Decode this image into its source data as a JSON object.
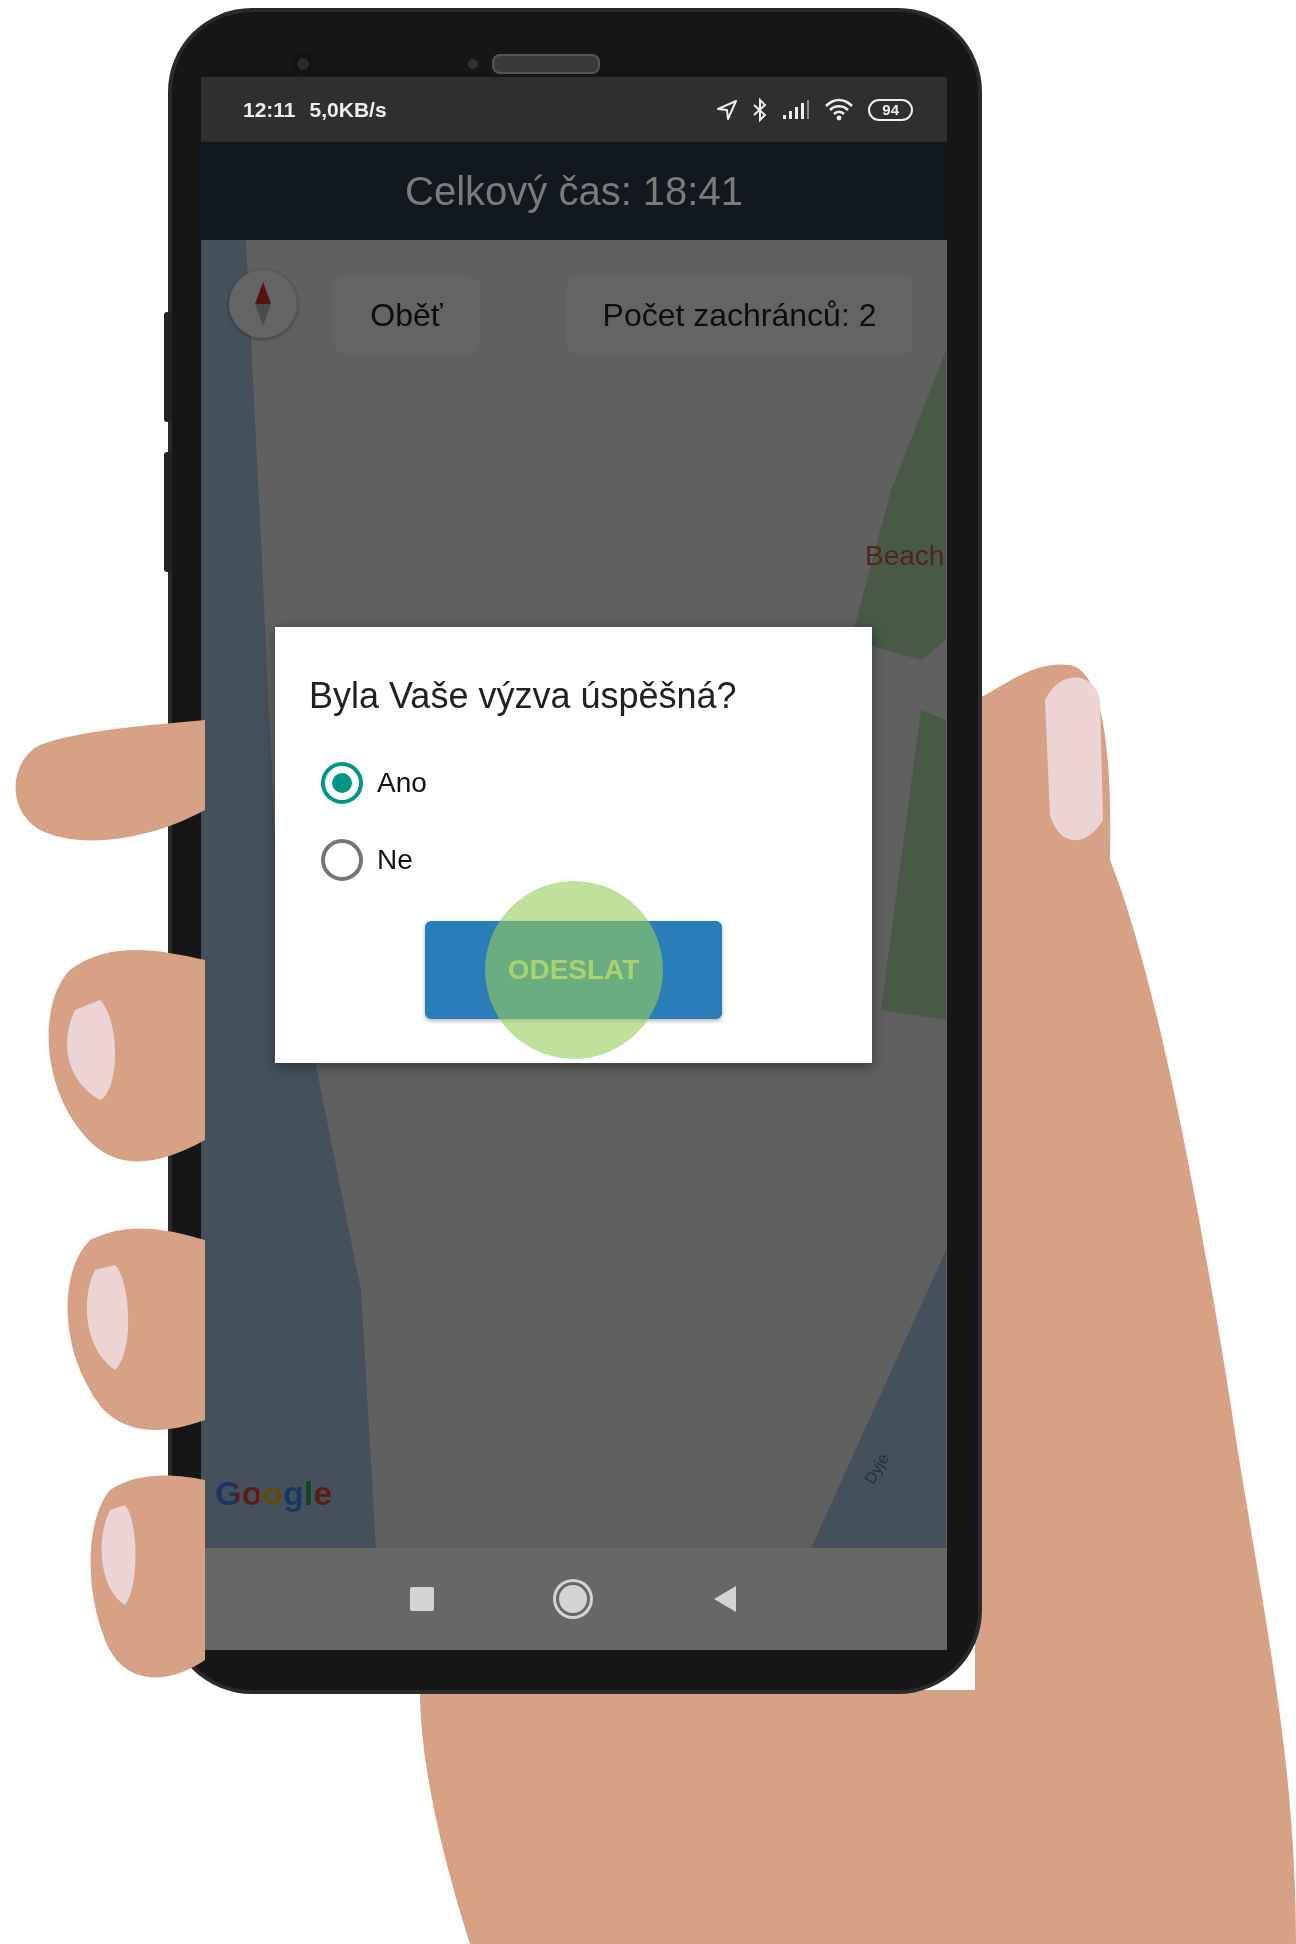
{
  "status_bar": {
    "time": "12:11",
    "speed": "5,0KB/s",
    "battery": "94"
  },
  "header": {
    "title": "Celkový čas: 18:41"
  },
  "map": {
    "chips": [
      "Oběť",
      "Počet zachránců: 2"
    ],
    "labels": [
      {
        "text": "Beach",
        "kind": "place"
      },
      {
        "text": "Dyje",
        "kind": "river"
      }
    ],
    "attribution": "Google"
  },
  "dialog": {
    "title": "Byla Vaše výzva úspěšná?",
    "options": [
      {
        "label": "Ano",
        "selected": true
      },
      {
        "label": "Ne",
        "selected": false
      }
    ],
    "button": "ODESLAT",
    "touch_indicator": true
  }
}
